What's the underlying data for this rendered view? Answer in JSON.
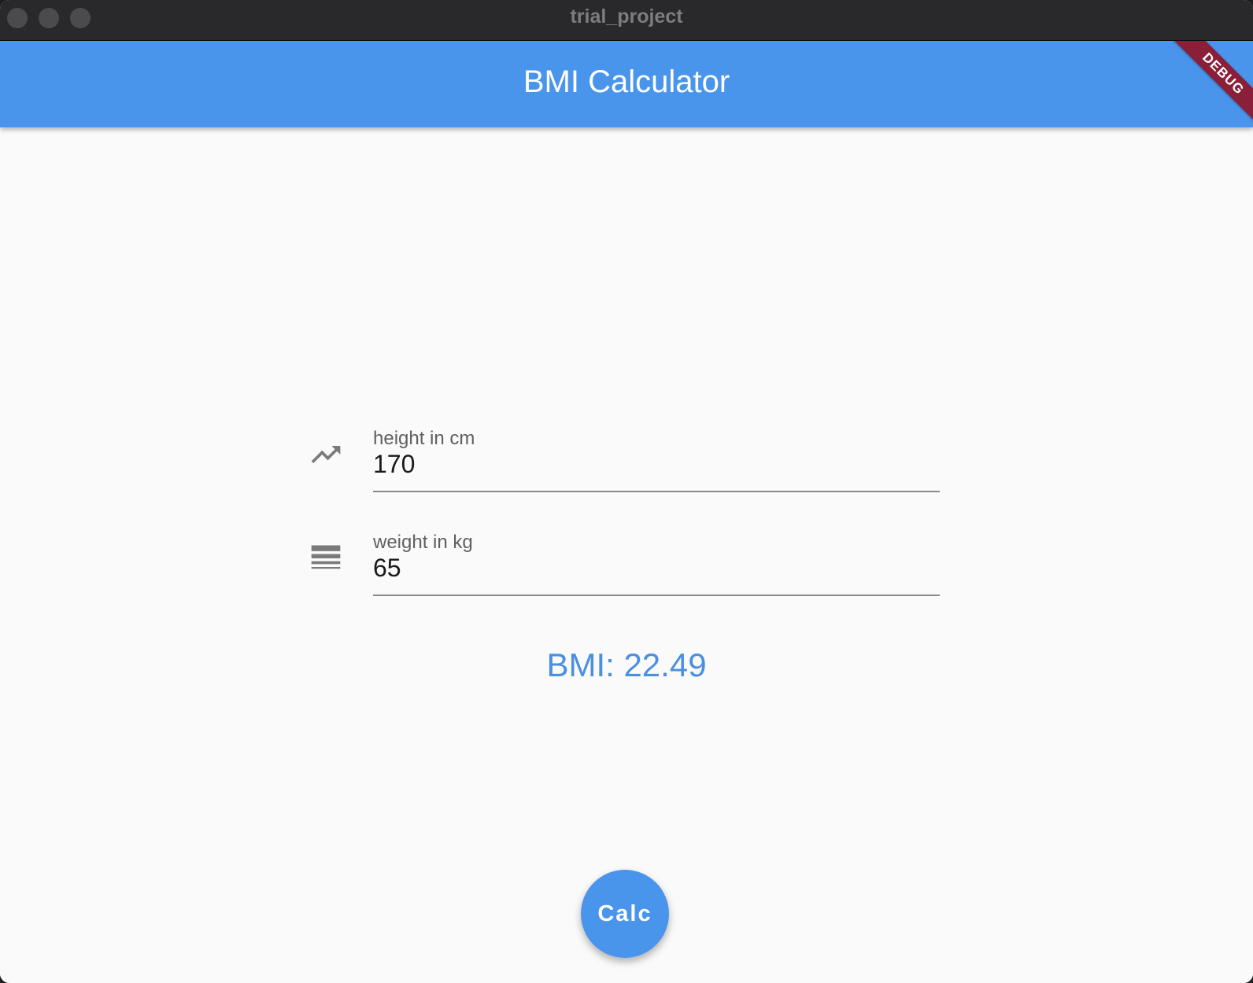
{
  "window": {
    "title": "trial_project"
  },
  "appbar": {
    "title": "BMI Calculator",
    "debug_banner": "DEBUG"
  },
  "form": {
    "height": {
      "label": "height in cm",
      "value": "170",
      "icon": "trending-up-icon"
    },
    "weight": {
      "label": "weight in kg",
      "value": "65",
      "icon": "line-weight-icon"
    }
  },
  "result": {
    "text": "BMI: 22.49"
  },
  "fab": {
    "label": "Calc"
  },
  "colors": {
    "primary": "#4a95ec",
    "result_text": "#4a8fe0",
    "debug_ribbon": "#8a1f3a",
    "titlebar": "#29292b",
    "background": "#fafafa"
  }
}
